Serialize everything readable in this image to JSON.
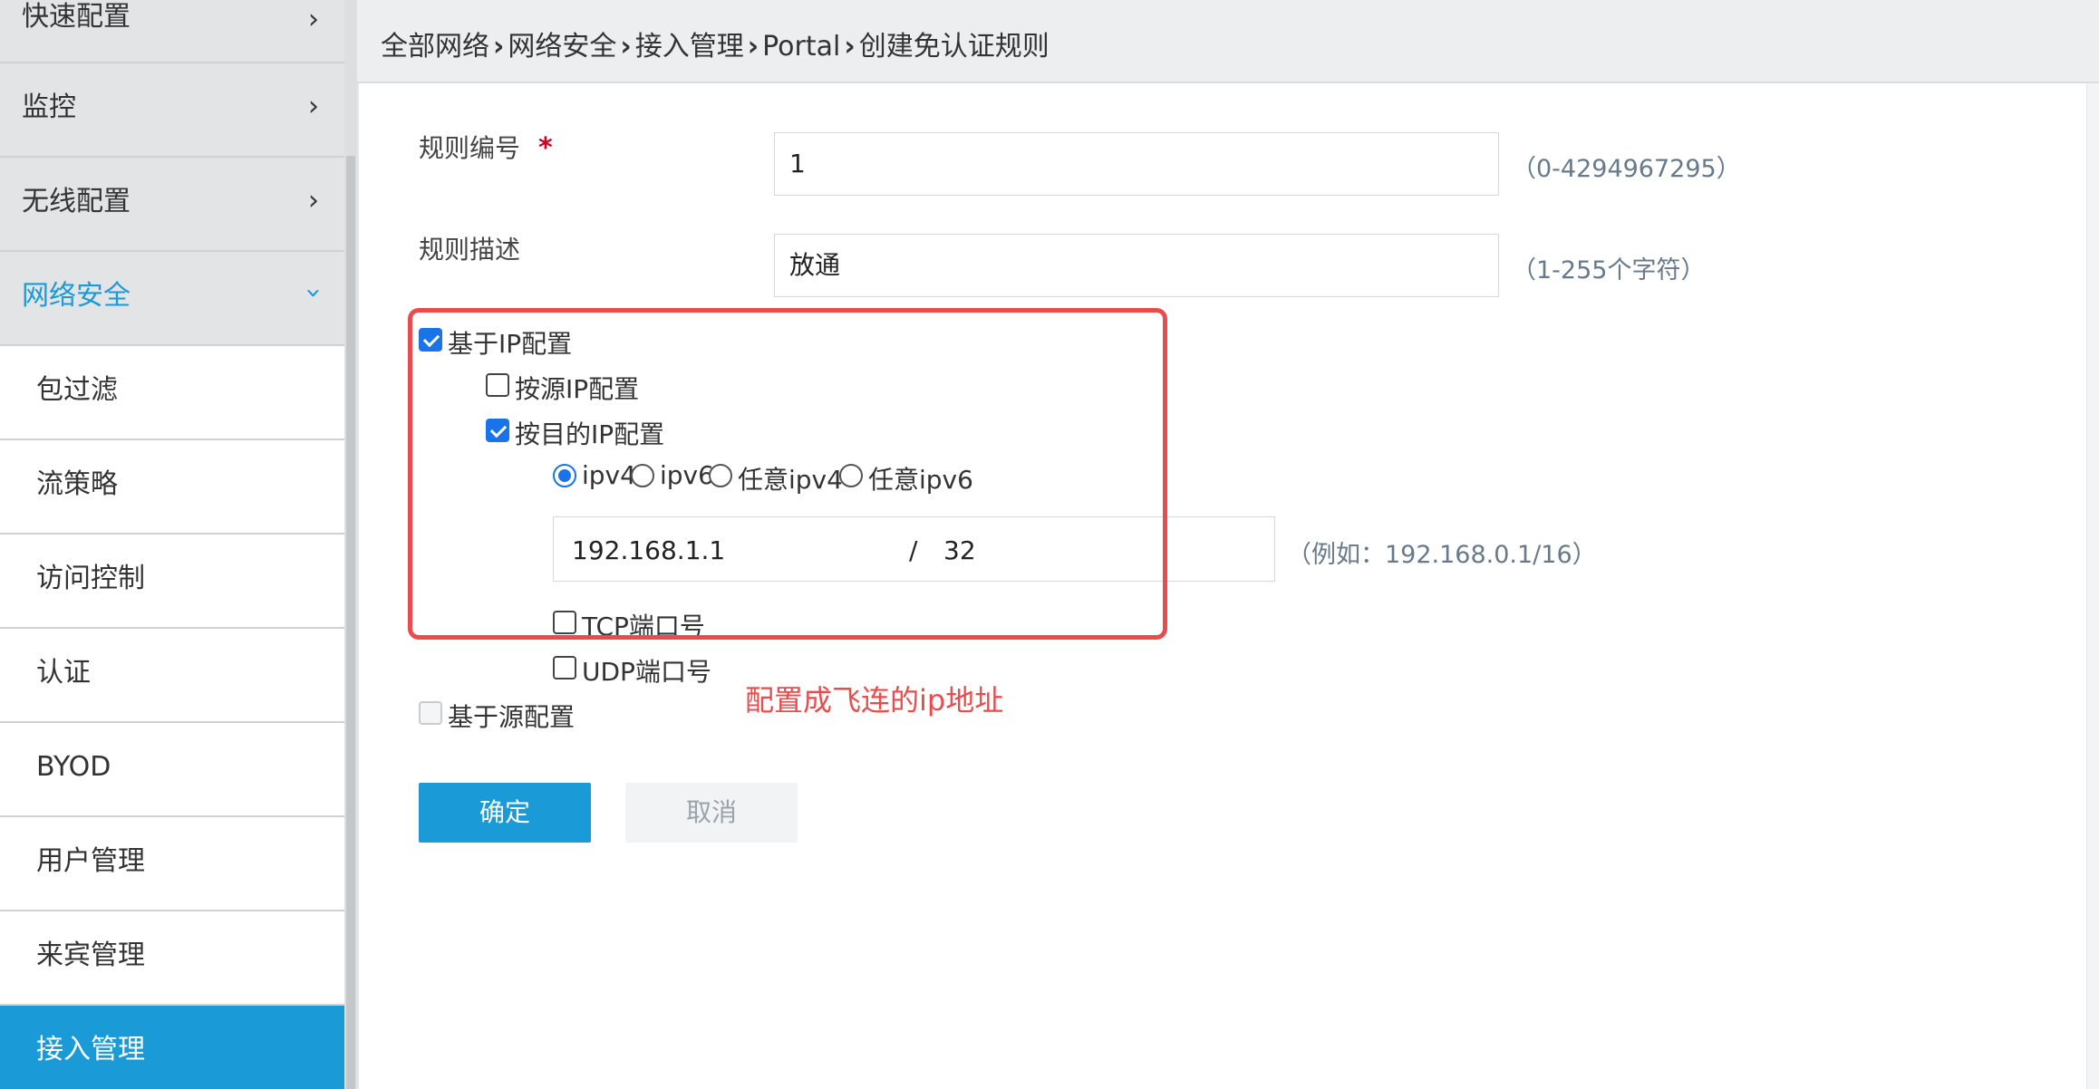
{
  "sidebar": {
    "top_items": [
      {
        "label": "快速配置"
      },
      {
        "label": "监控"
      },
      {
        "label": "无线配置"
      },
      {
        "label": "网络安全"
      }
    ],
    "sub_items": [
      {
        "label": "包过滤"
      },
      {
        "label": "流策略"
      },
      {
        "label": "访问控制"
      },
      {
        "label": "认证"
      },
      {
        "label": "BYOD"
      },
      {
        "label": "用户管理"
      },
      {
        "label": "来宾管理"
      },
      {
        "label": "接入管理"
      }
    ],
    "expanded_color": "#1a9ad6",
    "active_color": "#1a9ad6"
  },
  "breadcrumb": {
    "items": [
      "全部网络",
      "网络安全",
      "接入管理",
      "Portal",
      "创建免认证规则"
    ]
  },
  "form": {
    "rule_id": {
      "label": "规则编号",
      "required_mark": "*",
      "value": "1",
      "hint": "（0-4294967295）"
    },
    "rule_desc": {
      "label": "规则描述",
      "value": "放通",
      "hint": "（1-255个字符）"
    },
    "ip_based": {
      "label": "基于IP配置",
      "checked": true
    },
    "by_src_ip": {
      "label": "按源IP配置",
      "checked": false
    },
    "by_dst_ip": {
      "label": "按目的IP配置",
      "checked": true
    },
    "ip_type_options": [
      {
        "label": "ipv4",
        "selected": true
      },
      {
        "label": "ipv6",
        "selected": false
      },
      {
        "label": "任意ipv4",
        "selected": false
      },
      {
        "label": "任意ipv6",
        "selected": false
      }
    ],
    "dst_ip": {
      "address": "192.168.1.1",
      "separator": "/",
      "mask": "32",
      "hint": "（例如：192.168.0.1/16）"
    },
    "tcp_port": {
      "label": "TCP端口号",
      "checked": false
    },
    "udp_port": {
      "label": "UDP端口号",
      "checked": false
    },
    "source_based": {
      "label": "基于源配置",
      "checked": false,
      "disabled": true
    }
  },
  "annotation": {
    "text": "配置成飞连的ip地址",
    "color": "#e84c4c"
  },
  "buttons": {
    "confirm": "确定",
    "cancel": "取消"
  }
}
